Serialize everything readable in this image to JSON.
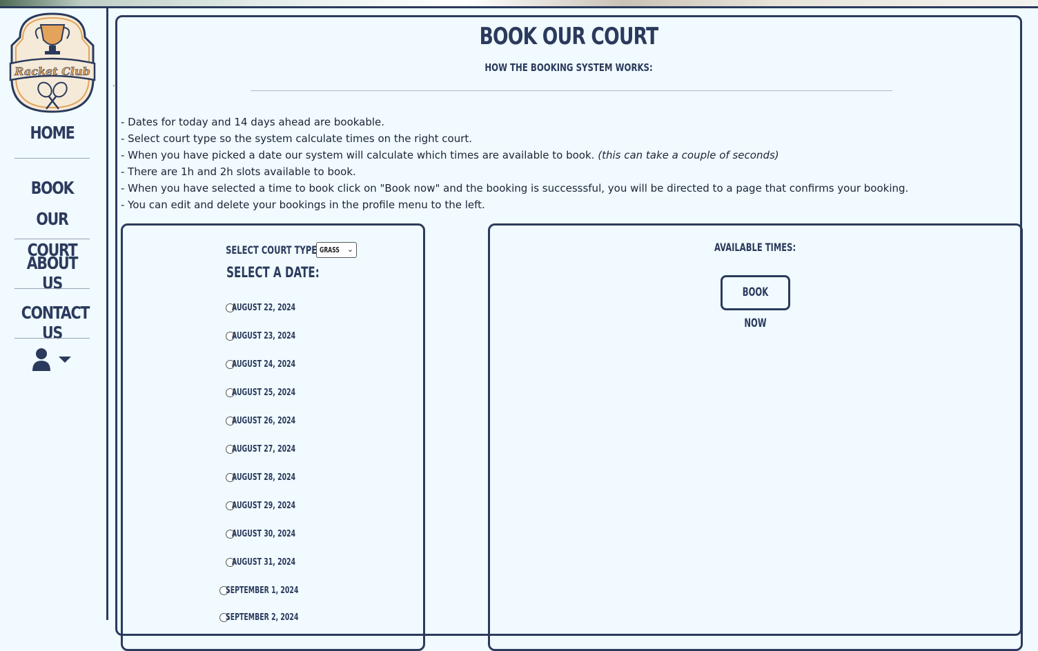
{
  "logo": {
    "line1": "Racket",
    "line2": "Club"
  },
  "nav": {
    "home": "HOME",
    "book_line1": "BOOK OUR",
    "book_line2": "COURT",
    "about": "ABOUT US",
    "contact": "CONTACT US"
  },
  "user_menu": {
    "icon": "user-icon",
    "caret": "caret-down-icon"
  },
  "page": {
    "title": "BOOK OUR COURT",
    "subtitle": "HOW THE BOOKING SYSTEM WORKS:",
    "instructions": [
      "- Dates for today and 14 days ahead are bookable.",
      "- Select court type so the system calculate times on the right court.",
      "- When you have picked a date our system will calculate which times are available to book.",
      "- There are 1h and 2h slots available to book.",
      "- When you have selected a time to book click on \"Book now\" and the booking is successsful, you will be directed to a page that confirms your booking.",
      "- You can edit and delete your bookings in the profile menu to the left."
    ],
    "instruction_note": "(this can take a couple of seconds)"
  },
  "booking": {
    "court_type_label": "SELECT COURT TYPE:",
    "court_type_value": "GRASS",
    "select_date_label": "SELECT A DATE:",
    "dates": [
      "AUGUST 22, 2024",
      "AUGUST 23, 2024",
      "AUGUST 24, 2024",
      "AUGUST 25, 2024",
      "AUGUST 26, 2024",
      "AUGUST 27, 2024",
      "AUGUST 28, 2024",
      "AUGUST 29, 2024",
      "AUGUST 30, 2024",
      "AUGUST 31, 2024",
      "SEPTEMBER 1, 2024",
      "SEPTEMBER 2, 2024"
    ]
  },
  "times": {
    "label": "AVAILABLE TIMES:",
    "book_button": "BOOK NOW"
  },
  "colors": {
    "navy": "#2b3a5c",
    "background": "#f0faff",
    "logo_gold": "#e3a35a",
    "logo_cream": "#f5ead8"
  }
}
